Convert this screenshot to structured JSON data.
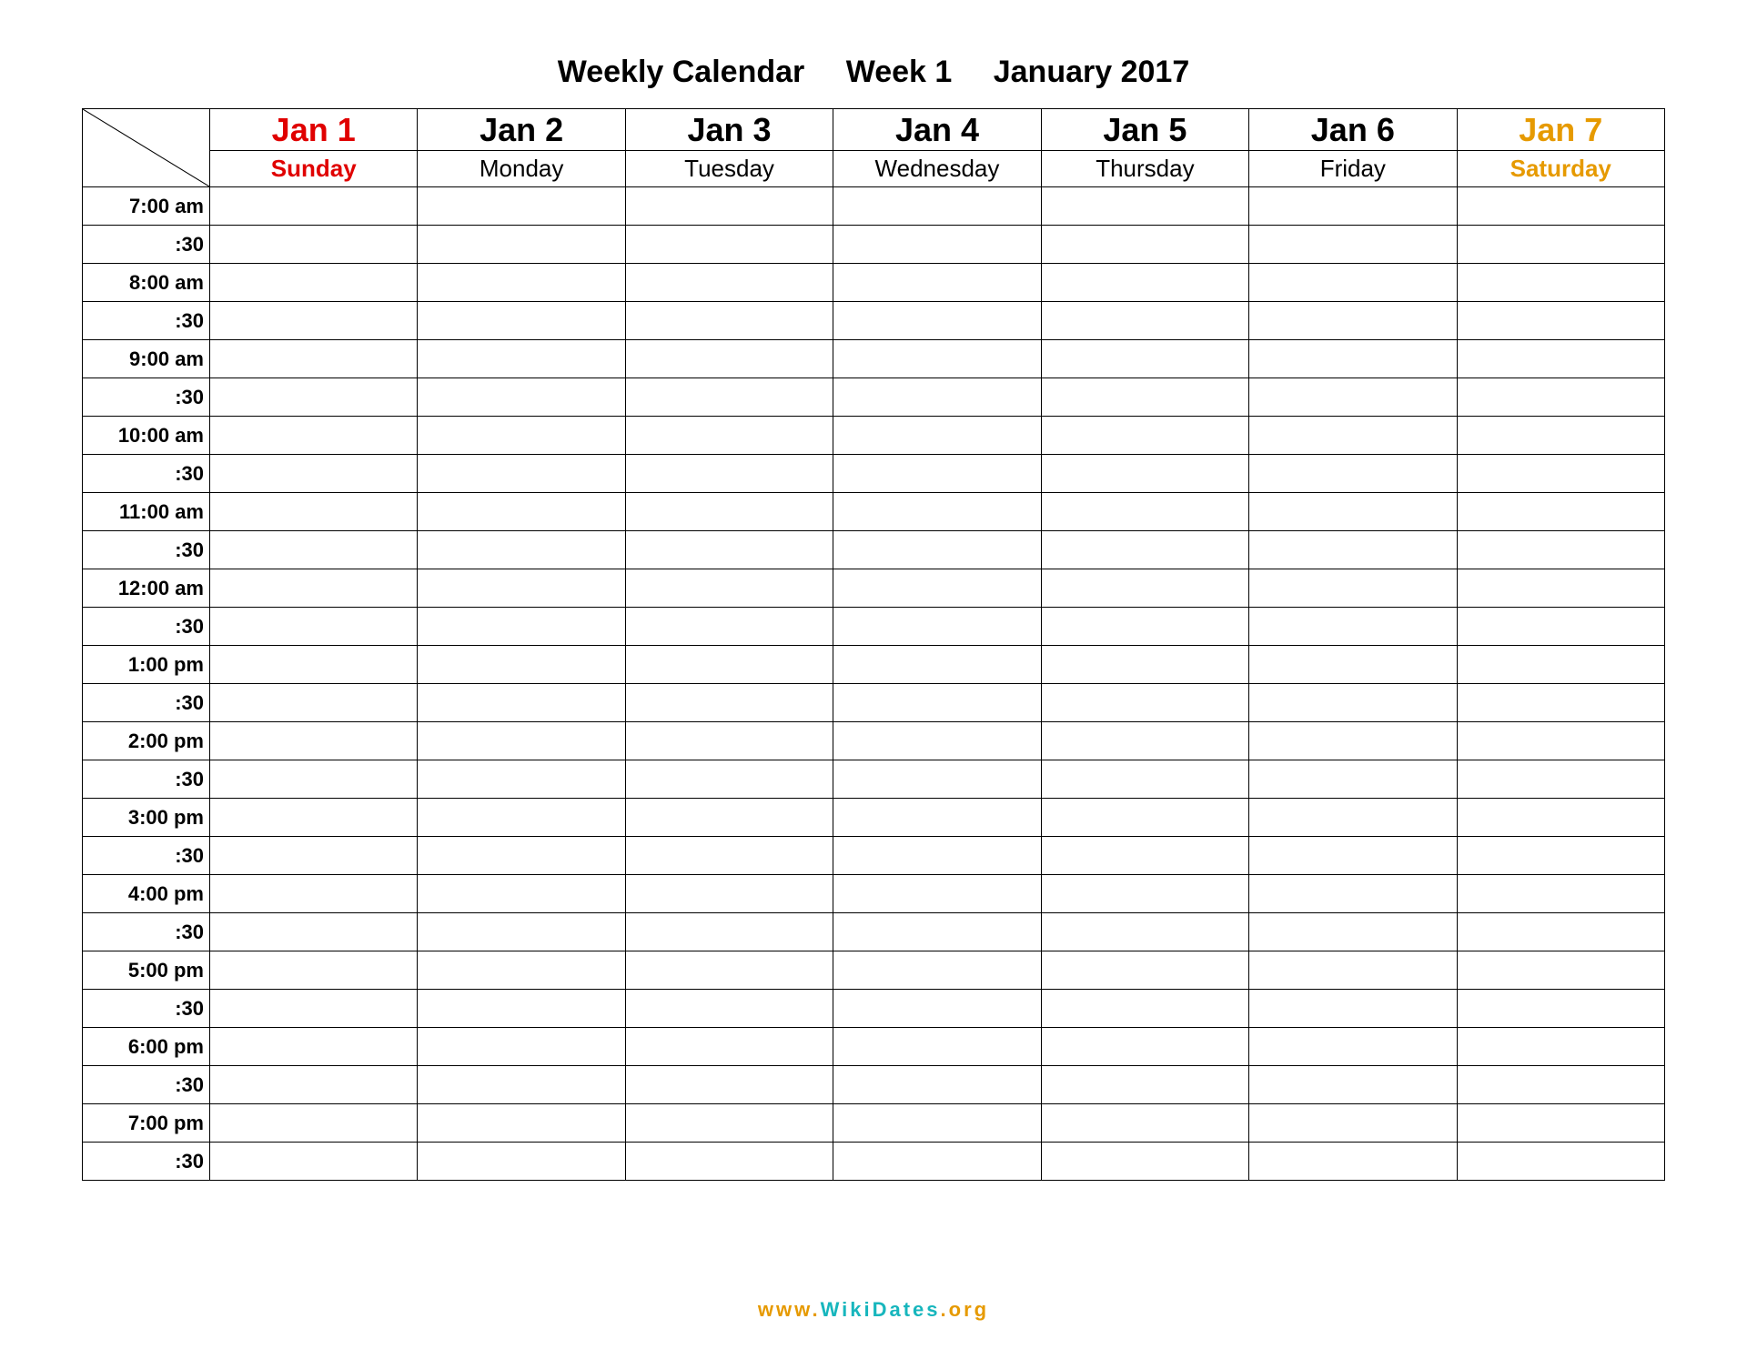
{
  "title": {
    "label": "Weekly Calendar",
    "week": "Week 1",
    "month": "January 2017"
  },
  "days": [
    {
      "date": "Jan 1",
      "name": "Sunday",
      "weekend": "sun"
    },
    {
      "date": "Jan 2",
      "name": "Monday",
      "weekend": ""
    },
    {
      "date": "Jan 3",
      "name": "Tuesday",
      "weekend": ""
    },
    {
      "date": "Jan 4",
      "name": "Wednesday",
      "weekend": ""
    },
    {
      "date": "Jan 5",
      "name": "Thursday",
      "weekend": ""
    },
    {
      "date": "Jan 6",
      "name": "Friday",
      "weekend": ""
    },
    {
      "date": "Jan 7",
      "name": "Saturday",
      "weekend": "sat"
    }
  ],
  "slots": [
    "7:00 am",
    ":30",
    "8:00 am",
    ":30",
    "9:00 am",
    ":30",
    "10:00 am",
    ":30",
    "11:00 am",
    ":30",
    "12:00 am",
    ":30",
    "1:00 pm",
    ":30",
    "2:00 pm",
    ":30",
    "3:00 pm",
    ":30",
    "4:00 pm",
    ":30",
    "5:00 pm",
    ":30",
    "6:00 pm",
    ":30",
    "7:00 pm",
    ":30"
  ],
  "footer": {
    "p1": "www.",
    "p2": "WikiDates",
    "p3": ".org"
  }
}
